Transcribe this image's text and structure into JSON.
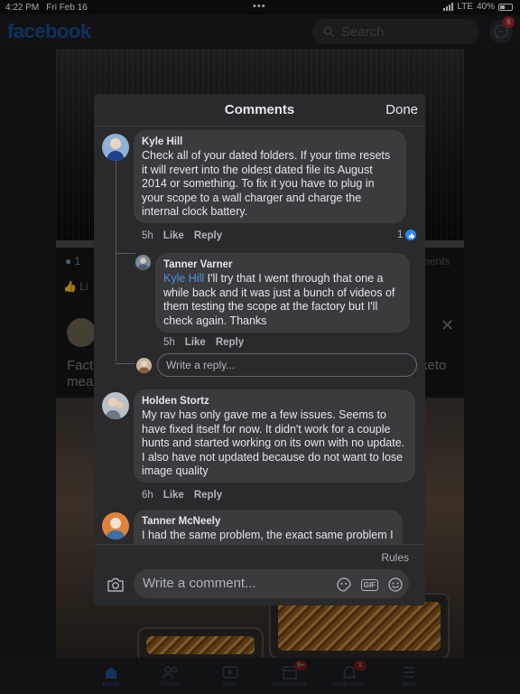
{
  "status_bar": {
    "time": "4:22 PM",
    "date": "Fri Feb 16",
    "dots": "•••",
    "network": "LTE",
    "battery": "40%"
  },
  "header": {
    "logo": "facebook",
    "search_placeholder": "Search",
    "messenger_badge": "6"
  },
  "background_feed": {
    "reaction_count": "1",
    "like_label": "Li",
    "comments_fragment": "ments",
    "post_text_fragment": "Fact",
    "post_text_fragment_2": "mea",
    "post_text_fragment_3": "keto"
  },
  "modal": {
    "title": "Comments",
    "done_label": "Done",
    "comments": [
      {
        "author": "Kyle Hill",
        "text": "Check all of your dated folders. If your time resets it will revert into the oldest dated file its August 2014 or something. To fix it you have to plug in your scope to a wall charger and charge the internal clock battery.",
        "time": "5h",
        "like": "Like",
        "reply": "Reply",
        "like_count": "1"
      },
      {
        "author": "Tanner Varner",
        "mention": "Kyle Hill",
        "text": " I'll try that I went through that one a while back and it was just a bunch of videos of them testing the scope at the factory but I'll check again. Thanks",
        "time": "5h",
        "like": "Like",
        "reply": "Reply"
      },
      {
        "author": "Holden Stortz",
        "text": "My rav has only gave me a few issues. Seems to have fixed itself for now. It didn't work for a couple hunts and started working on its own with no update. I also have not updated because do not want to lose image quality",
        "time": "6h",
        "like": "Like",
        "reply": "Reply"
      },
      {
        "author": "Tanner McNeely",
        "text": "I had the same problem, the exact same problem I emailed Rico and th"
      }
    ],
    "reply_placeholder": "Write a reply...",
    "rules_label": "Rules",
    "comment_placeholder": "Write a comment..."
  },
  "bottom_nav": [
    {
      "label": "Home",
      "badge": ""
    },
    {
      "label": "Friends",
      "badge": ""
    },
    {
      "label": "Video",
      "badge": ""
    },
    {
      "label": "Marketplace",
      "badge": "9+"
    },
    {
      "label": "Notifications",
      "badge": "1"
    },
    {
      "label": "Menu",
      "badge": ""
    }
  ]
}
